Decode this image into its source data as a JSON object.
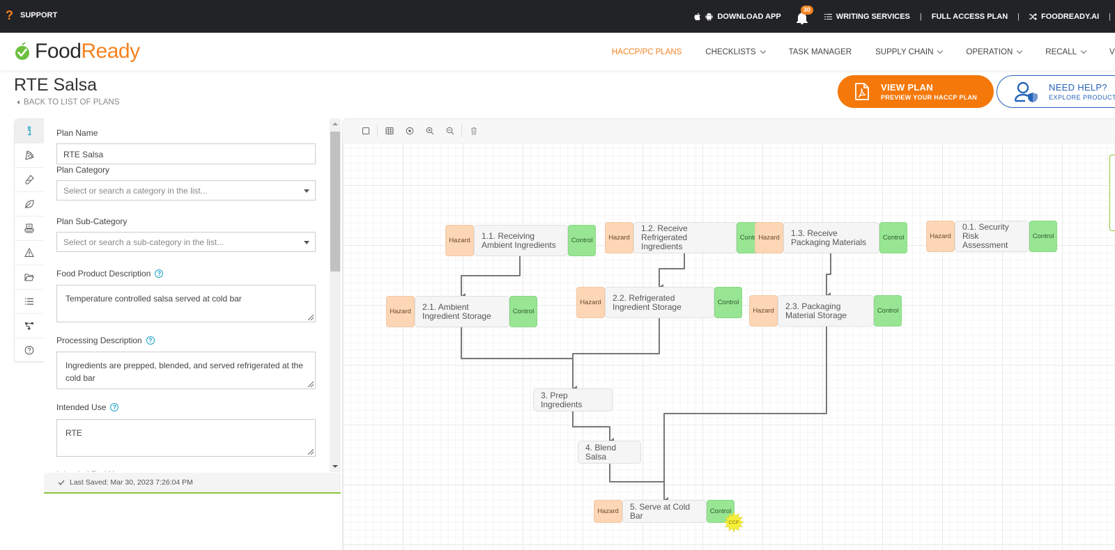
{
  "topbar": {
    "support": "SUPPORT",
    "download_app": "DOWNLOAD APP",
    "notification_count": "30",
    "writing_services": "WRITING SERVICES",
    "full_access_plan": "FULL ACCESS PLAN",
    "foodready_ai": "FOODREADY.AI",
    "separator": "|"
  },
  "logo": {
    "food": "Food",
    "ready": "Ready"
  },
  "nav": {
    "items": [
      {
        "label": "HACCP/PC PLANS",
        "active": true,
        "dropdown": false
      },
      {
        "label": "CHECKLISTS",
        "dropdown": true
      },
      {
        "label": "TASK MANAGER",
        "dropdown": false
      },
      {
        "label": "SUPPLY CHAIN",
        "dropdown": true
      },
      {
        "label": "OPERATION",
        "dropdown": true
      },
      {
        "label": "RECALL",
        "dropdown": true
      },
      {
        "label": "VERIFICATION",
        "dropdown": false
      }
    ]
  },
  "page": {
    "title": "RTE Salsa",
    "back_link": "BACK TO LIST OF PLANS",
    "view_plan": {
      "title": "VIEW PLAN",
      "subtitle": "PREVIEW YOUR HACCP PLAN"
    },
    "need_help": {
      "title": "NEED HELP?",
      "subtitle": "EXPLORE PRODUCTS"
    }
  },
  "side_tabs": [
    {
      "icon": "info-icon",
      "active": true
    },
    {
      "icon": "pizza-icon"
    },
    {
      "icon": "test-tube-icon"
    },
    {
      "icon": "leaf-icon"
    },
    {
      "icon": "machine-icon"
    },
    {
      "icon": "warning-icon"
    },
    {
      "icon": "folder-icon"
    },
    {
      "icon": "list-icon"
    },
    {
      "icon": "flow-diagram-icon"
    },
    {
      "icon": "help-icon"
    }
  ],
  "form": {
    "plan_name": {
      "label": "Plan Name",
      "value": "RTE Salsa"
    },
    "plan_category": {
      "label": "Plan Category",
      "placeholder": "Select or search a category in the list..."
    },
    "plan_subcategory": {
      "label": "Plan Sub-Category",
      "placeholder": "Select or search a sub-category in the list..."
    },
    "food_product_description": {
      "label": "Food Product Description",
      "value": "Temperature controlled salsa served at cold bar"
    },
    "processing_description": {
      "label": "Processing Description",
      "value": "Ingredients are prepped, blended, and served refrigerated at the cold bar"
    },
    "intended_use": {
      "label": "Intended Use",
      "value": "RTE"
    },
    "next_label_partial": "Intended End User"
  },
  "status": {
    "last_saved": "Last Saved: Mar 30, 2023 7:26:04 PM"
  },
  "toolbar": {
    "buttons": [
      "select-icon",
      "grid-icon",
      "center-icon",
      "zoom-in-icon",
      "zoom-out-icon",
      "delete-icon"
    ]
  },
  "flow": {
    "hazard_label": "Hazard",
    "control_label": "Control",
    "ccp_label": "CCP",
    "nodes": [
      {
        "id": "n11",
        "label": "1.1. Receiving Ambient Ingredients",
        "hazard": true,
        "control": true
      },
      {
        "id": "n12",
        "label": "1.2. Receive Refrigerated Ingredients",
        "hazard": true,
        "control": true
      },
      {
        "id": "n13",
        "label": "1.3. Receive Packaging Materials",
        "hazard": true,
        "control": true
      },
      {
        "id": "n01",
        "label": "0.1. Security Risk Assessment",
        "hazard": true,
        "control": true
      },
      {
        "id": "n21",
        "label": "2.1. Ambient Ingredient Storage",
        "hazard": true,
        "control": true
      },
      {
        "id": "n22",
        "label": "2.2. Refrigerated Ingredient Storage",
        "hazard": true,
        "control": true
      },
      {
        "id": "n23",
        "label": "2.3. Packaging Material Storage",
        "hazard": true,
        "control": true
      },
      {
        "id": "n3",
        "label": "3. Prep Ingredients",
        "hazard": false,
        "control": false
      },
      {
        "id": "n4",
        "label": "4. Blend Salsa",
        "hazard": false,
        "control": false
      },
      {
        "id": "n5",
        "label": "5. Serve at Cold Bar",
        "hazard": true,
        "control": true,
        "ccp": true
      }
    ],
    "edges": [
      [
        "n11",
        "n21"
      ],
      [
        "n12",
        "n22"
      ],
      [
        "n13",
        "n23"
      ],
      [
        "n21",
        "n3"
      ],
      [
        "n22",
        "n3"
      ],
      [
        "n3",
        "n4"
      ],
      [
        "n4",
        "n5"
      ],
      [
        "n23",
        "n5"
      ]
    ]
  }
}
